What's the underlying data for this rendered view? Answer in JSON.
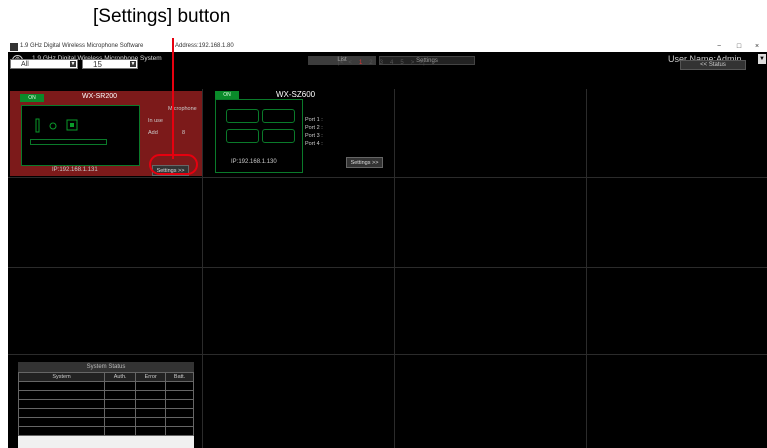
{
  "annotation": {
    "label": "[Settings] button"
  },
  "window": {
    "title": "1.9 GHz Digital Wireless Microphone Software",
    "address": "Address:192.168.1.80",
    "controls": {
      "minimize": "−",
      "maximize": "□",
      "close": "×"
    }
  },
  "header": {
    "system_title": "1.9 GHz Digital Wireless Microphone System",
    "tabs": [
      {
        "label": "List"
      },
      {
        "label": "Settings"
      }
    ],
    "user_name": "User Name:Admin"
  },
  "filters": {
    "group": "All",
    "count": "15"
  },
  "pager": {
    "first": "|<",
    "prev": "<",
    "pages": [
      "1",
      "2",
      "3",
      "4",
      "5"
    ],
    "current": "1",
    "next": ">",
    "last": ">|"
  },
  "status_button": "<< Status",
  "devices": [
    {
      "status": "ON",
      "model": "WX-SR200",
      "labels": {
        "microphone": "Microphone",
        "in_use": "In use",
        "add": "Add"
      },
      "add_value": "8",
      "ip": "IP:192.168.1.131",
      "settings_label": "Settings >>"
    },
    {
      "status": "ON",
      "model": "WX-SZ600",
      "ports": [
        "Port 1 :",
        "Port 2 :",
        "Port 3 :",
        "Port 4 :"
      ],
      "ip": "IP:192.168.1.130",
      "settings_label": "Settings >>"
    }
  ],
  "system_status": {
    "title": "System Status",
    "columns": [
      "System",
      "Auth.",
      "Error",
      "Batt."
    ]
  },
  "colors": {
    "selected_cell": "#7c1a1a",
    "on_badge": "#0a8a2a",
    "annotation": "#e6000f",
    "page_current": "#dd3333"
  }
}
